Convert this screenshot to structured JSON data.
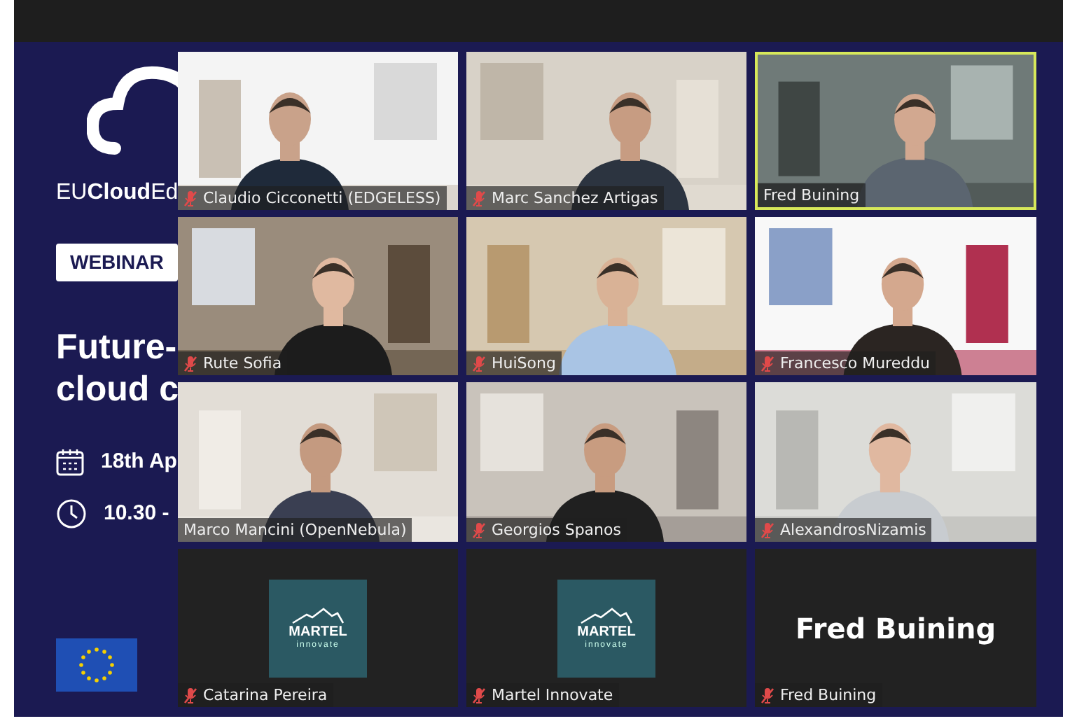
{
  "shared_slide": {
    "brand": "EU**Cloud**Ed",
    "badge": "WEBINAR",
    "title_lines": [
      "Future-",
      "cloud c"
    ],
    "date": "18th Ap",
    "time": "10.30 - "
  },
  "participants": [
    {
      "name": "Claudio Cicconetti (EDGELESS)",
      "kind": "video",
      "muted": true,
      "speaking": false
    },
    {
      "name": "Marc Sanchez Artigas",
      "kind": "video",
      "muted": true,
      "speaking": false
    },
    {
      "name": "Fred Buining",
      "kind": "video",
      "muted": false,
      "speaking": true
    },
    {
      "name": "Rute Sofia",
      "kind": "video",
      "muted": true,
      "speaking": false
    },
    {
      "name": "HuiSong",
      "kind": "video",
      "muted": true,
      "speaking": false
    },
    {
      "name": "Francesco Mureddu",
      "kind": "video",
      "muted": true,
      "speaking": false
    },
    {
      "name": "Marco Mancini (OpenNebula)",
      "kind": "video",
      "muted": false,
      "speaking": false
    },
    {
      "name": "Georgios Spanos",
      "kind": "video",
      "muted": true,
      "speaking": false
    },
    {
      "name": "AlexandrosNizamis",
      "kind": "video",
      "muted": true,
      "speaking": false
    },
    {
      "name": "Catarina Pereira",
      "kind": "logo",
      "logo_title": "MARTEL",
      "logo_subtitle": "innovate",
      "muted": true,
      "speaking": false
    },
    {
      "name": "Martel Innovate",
      "kind": "logo",
      "logo_title": "MARTEL",
      "logo_subtitle": "innovate",
      "muted": true,
      "speaking": false
    },
    {
      "name": "Fred Buining",
      "kind": "name_card",
      "card_text": "Fred Buining",
      "muted": true,
      "speaking": false
    }
  ]
}
